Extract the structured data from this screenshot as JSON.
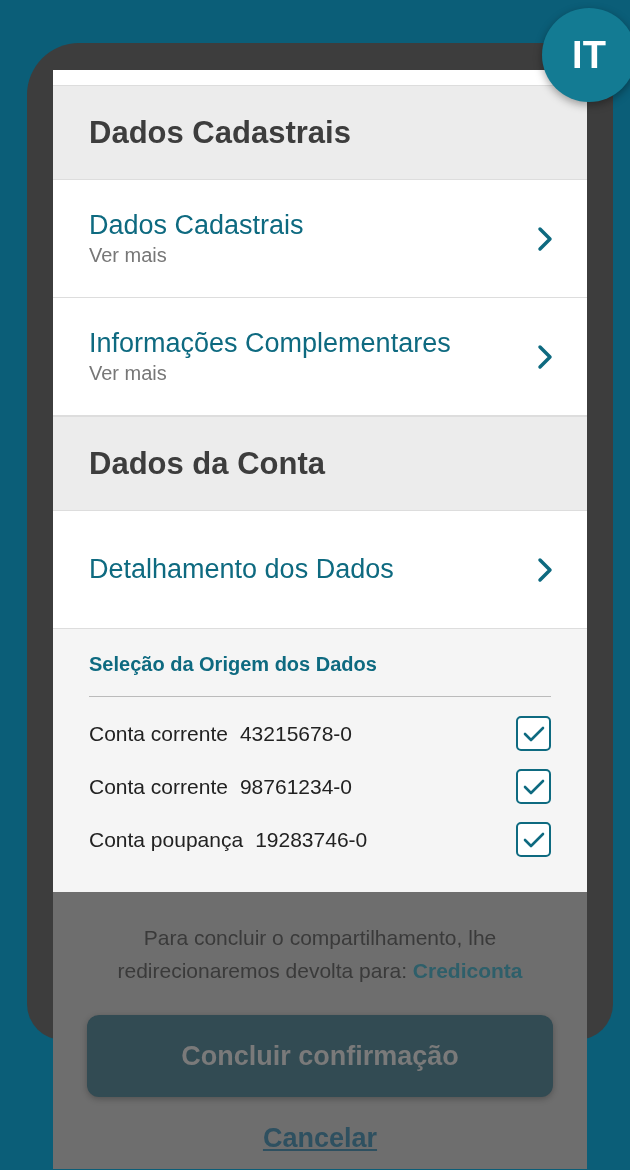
{
  "badge": "IT",
  "sections": [
    {
      "title": "Dados Cadastrais",
      "items": [
        {
          "title": "Dados Cadastrais",
          "subtitle": "Ver mais"
        },
        {
          "title": "Informações Complementares",
          "subtitle": "Ver mais"
        }
      ]
    },
    {
      "title": "Dados da Conta",
      "items": [
        {
          "title": "Detalhamento dos Dados"
        }
      ],
      "origin": {
        "title": "Seleção da Origem dos Dados",
        "accounts": [
          {
            "type": "Conta corrente",
            "number": "43215678-0",
            "checked": true
          },
          {
            "type": "Conta corrente",
            "number": "98761234-0",
            "checked": true
          },
          {
            "type": "Conta poupança",
            "number": "19283746-0",
            "checked": true
          }
        ]
      }
    }
  ],
  "footer": {
    "message": "Para concluir o compartilhamento, lhe redirecionaremos devolta para: **Crediconta**",
    "confirm_button": "Concluir confirmação",
    "cancel_link": "Cancelar"
  }
}
